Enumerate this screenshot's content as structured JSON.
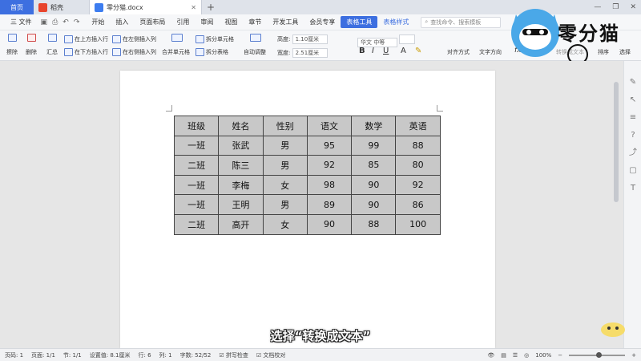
{
  "titlebar": {
    "tabs": [
      {
        "label": "首页"
      },
      {
        "label": "稻壳"
      },
      {
        "label": "零分猫.docx"
      }
    ],
    "new_tab": "+"
  },
  "menubar": {
    "file": "三 文件",
    "items": [
      "开始",
      "插入",
      "页面布局",
      "引用",
      "审阅",
      "视图",
      "章节",
      "开发工具",
      "会员专享"
    ],
    "active_tab": "表格工具",
    "style_tab": "表格样式",
    "search_placeholder": "查找命令、搜索模板"
  },
  "ribbon": {
    "delete_cells": "擦除",
    "delete": "删除",
    "summary": "汇总",
    "insert_above": "在上方插入行",
    "insert_below": "在下方插入行",
    "insert_left": "在左侧插入列",
    "insert_right": "在右侧插入列",
    "merge_cells": "合并单元格",
    "split_cells": "拆分单元格",
    "split_table": "拆分表格",
    "auto_fit": "自动调整",
    "height_label": "高度:",
    "height_value": "1.10厘米",
    "width_label": "宽度:",
    "width_value": "2.51厘米",
    "font_name": "华文 中等",
    "align": "对齐方式",
    "text_dir": "文字方向",
    "formula": "fx",
    "convert_text": "转换成文本",
    "sort": "排序",
    "select": "选择"
  },
  "table": {
    "rows": [
      [
        "班级",
        "姓名",
        "性别",
        "语文",
        "数学",
        "英语"
      ],
      [
        "一班",
        "张武",
        "男",
        "95",
        "99",
        "88"
      ],
      [
        "二班",
        "陈三",
        "男",
        "92",
        "85",
        "80"
      ],
      [
        "一班",
        "李梅",
        "女",
        "98",
        "90",
        "92"
      ],
      [
        "一班",
        "王明",
        "男",
        "89",
        "90",
        "86"
      ],
      [
        "二班",
        "高开",
        "女",
        "90",
        "88",
        "100"
      ]
    ]
  },
  "statusbar": {
    "page": "页码: 1",
    "pages": "页面: 1/1",
    "section": "节: 1/1",
    "setting": "设置值: 8.1厘米",
    "row": "行: 6",
    "col": "列: 1",
    "words": "字数: 52/52",
    "spell": "拼写检查",
    "proof": "文档校对",
    "zoom": "100%"
  },
  "subtitle": "选择“转换成文本”",
  "logo": {
    "text": "零分猫"
  }
}
